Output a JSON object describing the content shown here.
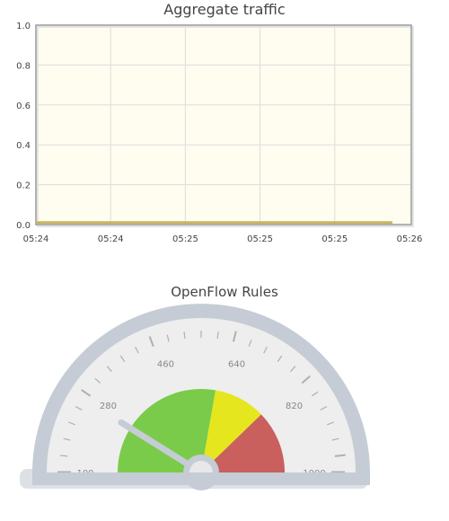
{
  "traffic": {
    "title": "Aggregate traffic",
    "chart_data": {
      "type": "line",
      "title": "Aggregate traffic",
      "xlabel": "",
      "ylabel": "",
      "x_tick_labels": [
        "05:24",
        "05:24",
        "05:25",
        "05:25",
        "05:25",
        "05:26"
      ],
      "y_tick_labels": [
        "0.0",
        "0.2",
        "0.4",
        "0.6",
        "0.8",
        "1.0"
      ],
      "y_ticks": [
        0,
        0.2,
        0.4,
        0.6,
        0.8,
        1.0
      ],
      "ylim": [
        0,
        1.0
      ],
      "grid": true,
      "series": [
        {
          "color": "#c8b560",
          "x": [
            0,
            0.1,
            0.2,
            0.3,
            0.4,
            0.5,
            0.6,
            0.7,
            0.8,
            0.9,
            1.0
          ],
          "values": [
            0.01,
            0.01,
            0.01,
            0.01,
            0.01,
            0.01,
            0.01,
            0.01,
            0.01,
            0.01,
            0.01
          ]
        }
      ],
      "colors": {
        "plot_background": "#fffcf0",
        "grid": "#dddddd",
        "frame": "#999999"
      }
    }
  },
  "rules": {
    "title": "OpenFlow Rules",
    "chart_data": {
      "type": "gauge",
      "title": "OpenFlow Rules",
      "min": 100,
      "max": 1000,
      "value": 260,
      "labels": [
        "100",
        "280",
        "460",
        "640",
        "820",
        "1000"
      ],
      "label_values": [
        100,
        280,
        460,
        640,
        820,
        1000
      ],
      "bands": [
        {
          "from": 100,
          "to": 600,
          "color": "#7acb4a"
        },
        {
          "from": 600,
          "to": 780,
          "color": "#e6e61e"
        },
        {
          "from": 780,
          "to": 1000,
          "color": "#c9605e"
        }
      ],
      "colors": {
        "rim": "#c5ccd6",
        "face": "#eeeeee",
        "needle": "#c5ccd6",
        "ticks": "#b0b0b0"
      }
    }
  }
}
